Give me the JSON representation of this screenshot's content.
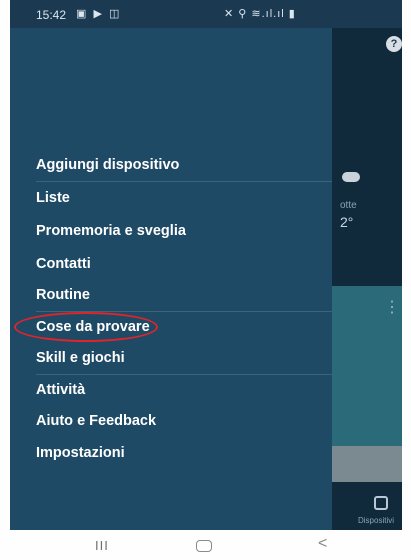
{
  "status_bar": {
    "time": "15:42",
    "left_icons": "▣ ▶ ◫",
    "right_icons": "✕ ⚲ ≋.ıl.ıl ▮"
  },
  "background": {
    "weather_label": "otte",
    "temperature": "2°",
    "devices_label": "Dispositivi",
    "help_symbol": "?"
  },
  "menu": {
    "items": [
      "Aggiungi dispositivo",
      "Liste",
      "Promemoria e sveglia",
      "Contatti",
      "Routine",
      "Cose da provare",
      "Skill e giochi",
      "Attività",
      "Aiuto e Feedback",
      "Impostazioni"
    ],
    "highlighted_item": "Skill e giochi"
  },
  "navbar": {
    "recent_symbol": "III",
    "back_symbol": "<"
  },
  "colors": {
    "drawer_bg": "#1f4a65",
    "app_bg": "#10293b",
    "highlight_circle": "#e0242a"
  }
}
